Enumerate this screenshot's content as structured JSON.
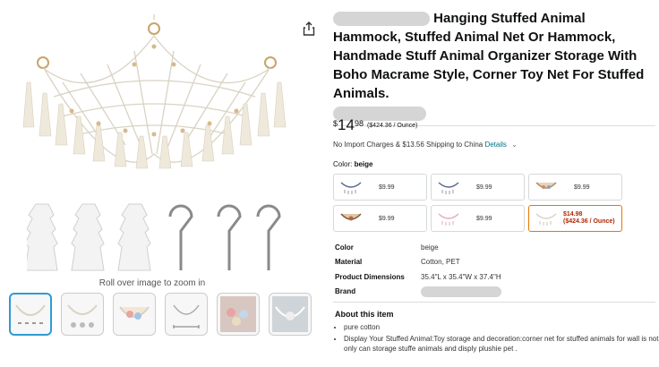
{
  "product": {
    "title": "Hanging Stuffed Animal Hammock, Stuffed Animal Net Or Hammock, Handmade Stuff Animal Organizer Storage With Boho Macrame Style, Corner Toy Net For Stuffed Animals."
  },
  "gallery": {
    "zoom_hint": "Roll over image to zoom in",
    "thumbnail_count": 6
  },
  "price": {
    "symbol": "$",
    "whole": "14",
    "fraction": "98",
    "unit_price": "($424.36 / Ounce)"
  },
  "shipping": {
    "text": "No Import Charges & $13.56 Shipping to China",
    "details_link": "Details"
  },
  "color_selector": {
    "label": "Color:",
    "selected": "beige",
    "options": [
      {
        "price": "$9.99"
      },
      {
        "price": "$9.99"
      },
      {
        "price": "$9.99"
      },
      {
        "price": "$9.99"
      },
      {
        "price": "$9.99"
      },
      {
        "price": "$14.98",
        "unit": "($424.36 / Ounce)"
      }
    ]
  },
  "specs": [
    {
      "key": "Color",
      "value": "beige"
    },
    {
      "key": "Material",
      "value": "Cotton, PET"
    },
    {
      "key": "Product Dimensions",
      "value": "35.4\"L x 35.4\"W x 37.4\"H"
    },
    {
      "key": "Brand",
      "value": ""
    }
  ],
  "about": {
    "heading": "About this item",
    "bullets": [
      "pure cotton",
      "Display Your Stuffed Animal:Toy storage and decoration:corner net for stuffed animals for wall is not only can storage stuffe animals and disply plushie pet ."
    ]
  },
  "colors": {
    "link": "#007185",
    "price_red": "#b12704",
    "selected_border": "#e77600",
    "active_thumb": "#2e9bd6"
  }
}
